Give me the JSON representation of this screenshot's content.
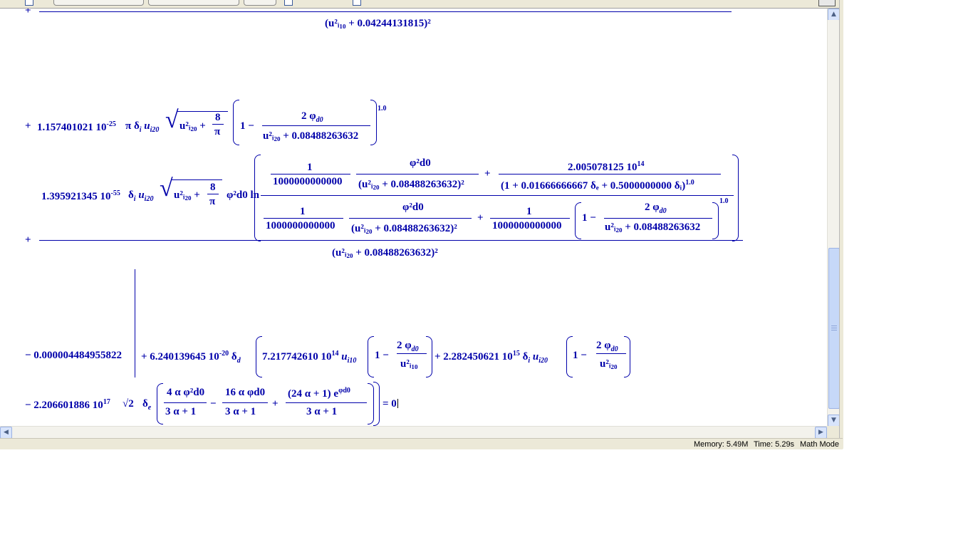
{
  "status": {
    "memory": "Memory: 5.49M",
    "time": "Time: 5.29s",
    "mode": "Math Mode"
  },
  "expr": {
    "plus": "+",
    "minus": "−",
    "r1_den": "(u²ᵢ₁₀ + 0.04244131815)²",
    "r2_coef": "1.157401021 10",
    "r2_exp": "-25",
    "r2_mid": "π δ",
    "r2_sqrt_a": "u²ᵢ₂₀ +",
    "r2_frac_num": "8",
    "r2_frac_den": "π",
    "r2_one_minus": "1 −",
    "r2_inner_num": "2 φ",
    "r2_inner_den": "u²ᵢ₂₀ + 0.08488263632",
    "r2_power": "1.0",
    "r3_coef": "1.395921345 10",
    "r3_exp": "-55",
    "r3_phi": "φ²d0 ln",
    "r3_one": "1",
    "r3_big": "1000000000000",
    "r3_phi2": "φ²d0",
    "r3_den_a": "(u²ᵢ₂₀ + 0.08488263632)²",
    "r3_term2_num": "2.005078125 10",
    "r3_term2_exp": "14",
    "r3_term2_den": "(1 + 0.01666666667 δₑ + 0.5000000000 δᵢ)",
    "r3_power": "1.0",
    "r3_outer_den": "(u²ᵢ₂₀ + 0.08488263632)²",
    "r4_const": "− 0.000004484955822",
    "r4_coef": "+ 6.240139645 10",
    "r4_exp": "-20",
    "r4_a": "7.217742610 10",
    "r4_a_exp": "14",
    "r4_b": "+ 2.282450621 10",
    "r4_b_exp": "15",
    "r4_den1": "u²ᵢ₁₀",
    "r4_den2": "u²ᵢ₂₀",
    "r5_coef": "− 2.206601886 10",
    "r5_exp": "17",
    "r5_sqrt": "√2",
    "r5_f1_num": "4 α φ²d0",
    "r5_f2_num": "16 α φd0",
    "r5_f3_num": "(24 α + 1) e",
    "r5_den": "3 α + 1",
    "r5_eq": "= 0"
  }
}
